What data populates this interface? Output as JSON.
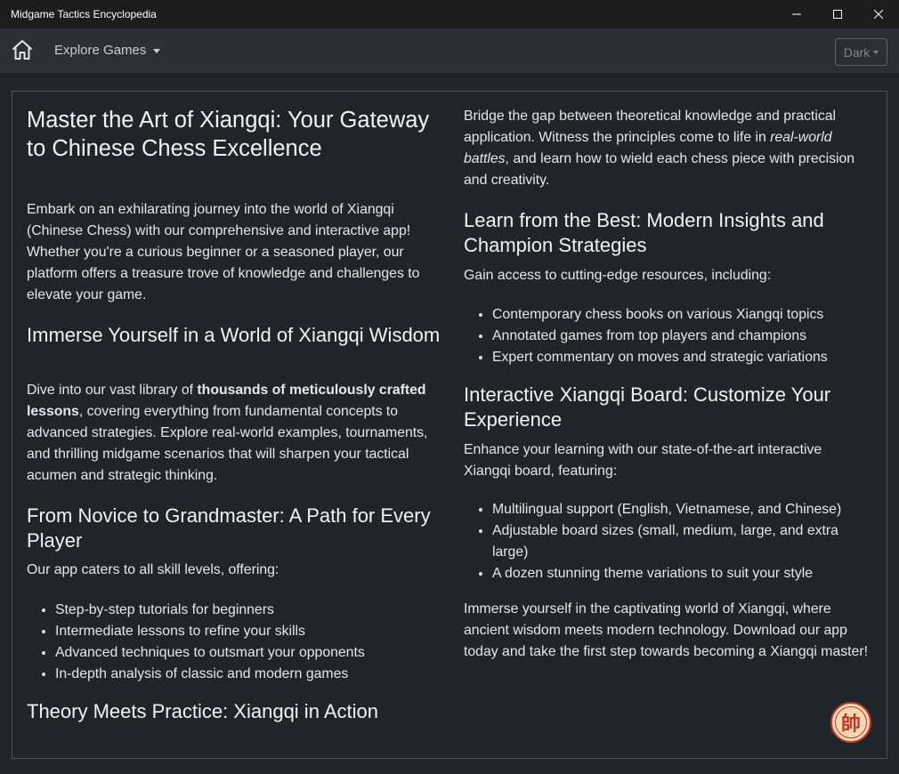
{
  "window": {
    "title": "Midgame Tactics Encyclopedia"
  },
  "nav": {
    "explore_label": "Explore Games",
    "theme_label": "Dark"
  },
  "left": {
    "title": "Master the Art of Xiangqi: Your Gateway to Chinese Chess Excellence",
    "intro": "Embark on an exhilarating journey into the world of Xiangqi (Chinese Chess) with our comprehensive and interactive app! Whether you're a curious beginner or a seasoned player, our platform offers a treasure trove of knowledge and challenges to elevate your game.",
    "immerse_heading": "Immerse Yourself in a World of Xiangqi Wisdom",
    "immerse_pre": "Dive into our vast library of ",
    "immerse_bold": "thousands of meticulously crafted lessons",
    "immerse_post": ", covering everything from fundamental concepts to advanced strategies. Explore real-world examples, tournaments, and thrilling midgame scenarios that will sharpen your tactical acumen and strategic thinking.",
    "novice_heading": "From Novice to Grandmaster: A Path for Every Player",
    "novice_text": "Our app caters to all skill levels, offering:",
    "novice_items": [
      "Step-by-step tutorials for beginners",
      "Intermediate lessons to refine your skills",
      "Advanced techniques to outsmart your opponents",
      "In-depth analysis of classic and modern games"
    ],
    "theory_heading": "Theory Meets Practice: Xiangqi in Action"
  },
  "right": {
    "theory_pre": "Bridge the gap between theoretical knowledge and practical application. Witness the principles come to life in ",
    "theory_italic": "real-world battles",
    "theory_post": ", and learn how to wield each chess piece with precision and creativity.",
    "best_heading": "Learn from the Best: Modern Insights and Champion Strategies",
    "best_text": "Gain access to cutting-edge resources, including:",
    "best_items": [
      "Contemporary chess books on various Xiangqi topics",
      "Annotated games from top players and champions",
      "Expert commentary on moves and strategic variations"
    ],
    "board_heading": "Interactive Xiangqi Board: Customize Your Experience",
    "board_text": "Enhance your learning with our state-of-the-art interactive Xiangqi board, featuring:",
    "board_items": [
      "Multilingual support (English, Vietnamese, and Chinese)",
      "Adjustable board sizes (small, medium, large, and extra large)",
      "A dozen stunning theme variations to suit your style"
    ],
    "closing": "Immerse yourself in the captivating world of Xiangqi, where ancient wisdom meets modern technology. Download our app today and take the first step towards becoming a Xiangqi master!"
  },
  "badge": {
    "glyph": "帥",
    "icon": "xiangqi-general-piece-icon"
  }
}
